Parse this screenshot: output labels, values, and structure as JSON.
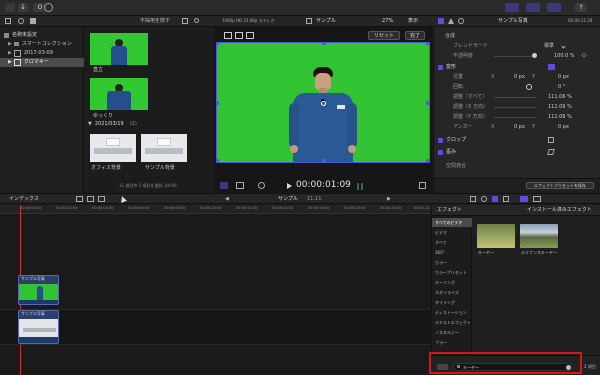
{
  "toolbar": {
    "key_icon_label": "O",
    "browser_sort": "不採用を隠す",
    "viewer_format": "1080p HD 23.98p ステレオ",
    "viewer_title": "サンプル",
    "zoom": "27%",
    "display_menu": "表示",
    "inspector_title": "サンプル写真",
    "inspector_time": "00:00:11:28"
  },
  "library": {
    "items": [
      {
        "label": "名称未設定"
      },
      {
        "label": "スマートコレクション"
      },
      {
        "label": "2017-03-09"
      },
      {
        "label": "クロマキー"
      }
    ]
  },
  "browser": {
    "clips_top": [
      {
        "label": "直立"
      },
      {
        "label": "ゆっくり"
      }
    ],
    "date_group": "2021/03/19",
    "date_count": "(2)",
    "clips_bottom": [
      {
        "label": "オフィス背景"
      },
      {
        "label": "サンプル背景"
      }
    ],
    "status": "11 項目中 1 項目を選択, 04:00"
  },
  "viewer": {
    "reset_label": "リセット",
    "done_label": "完了",
    "timecode": "00:00:01:09"
  },
  "inspector": {
    "section_composite": "合成",
    "blend_mode_label": "ブレンドモード",
    "blend_mode_value": "標準",
    "opacity_label": "不透明度",
    "opacity_value": "100.0 %",
    "transform_label": "変形",
    "position_label": "位置",
    "position_x_label": "X",
    "position_x_value": "0 px",
    "position_y_label": "Y",
    "position_y_value": "0 px",
    "rotation_label": "回転",
    "rotation_value": "0 °",
    "scale_all_label": "調整（すべて）",
    "scale_all_value": "111.06 %",
    "scale_x_label": "調整（X 方向）",
    "scale_x_value": "111.06 %",
    "scale_y_label": "調整（Y 方向）",
    "scale_y_value": "111.06 %",
    "anchor_label": "アンカー",
    "anchor_x_label": "X",
    "anchor_x_value": "0 px",
    "anchor_y_label": "Y",
    "anchor_y_value": "0 px",
    "crop_label": "クロップ",
    "distort_label": "歪み",
    "spatial_label": "空間適合",
    "save_preset": "エフェクトプリセットを保存"
  },
  "timeline": {
    "index_label": "インデックス",
    "project_name": "サンプル",
    "duration": "11:11",
    "ruler": [
      "00:00:00:00",
      "00:00:02:00",
      "00:00:04:00",
      "00:00:06:00",
      "00:00:08:00",
      "00:00:10:00",
      "00:00:12:00",
      "00:00:14:00",
      "00:00:16:00",
      "00:00:18:00",
      "00:00:20:00",
      "00:00:22:00"
    ],
    "clip_top_label": "サンプル写真",
    "clip_bottom_label": "サンプル写真"
  },
  "effects": {
    "title": "エフェクト",
    "installed_label": "インストール済みエフェクト",
    "categories": [
      "すべてのビデオ",
      "ビデオ",
      "すべて",
      "360°",
      "カラー",
      "カラープリセット",
      "キーイング",
      "スタイライズ",
      "タイリング",
      "ディストーション",
      "テキストエフェクト",
      "ノスタルジー",
      "ブラー"
    ],
    "thumbs": [
      {
        "label": "キーヤー"
      },
      {
        "label": "ルミナンスキーヤー"
      }
    ],
    "count": "2 項目",
    "search_value": "キーヤー"
  },
  "colors": {
    "accent": "#5a4de0",
    "highlight_box": "#d01818"
  }
}
